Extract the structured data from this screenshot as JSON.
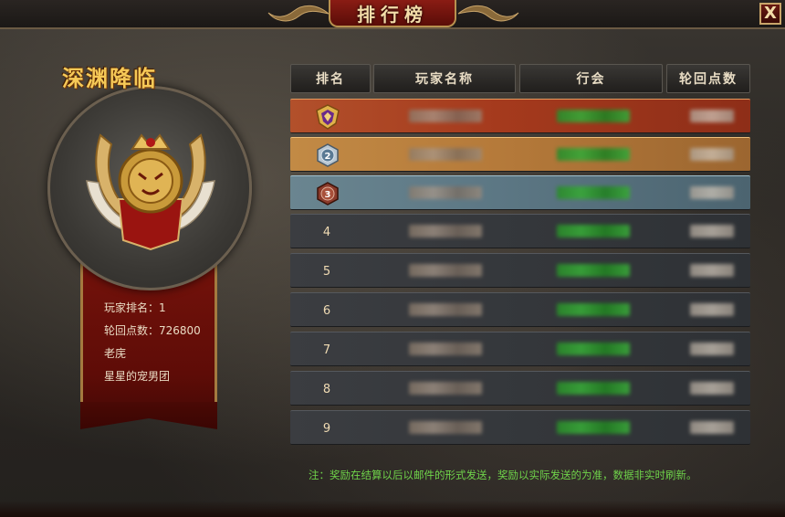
{
  "window": {
    "title": "排行榜",
    "close_label": "X"
  },
  "player": {
    "rank_title": "深渊降临",
    "rank_line": "玩家排名：1",
    "points_line": "轮回点数：726800",
    "name": "老庑",
    "guild": "星星的宠男团"
  },
  "table": {
    "headers": {
      "rank": "排名",
      "name": "玩家名称",
      "guild": "行会",
      "points": "轮回点数"
    },
    "rows": [
      {
        "rank": "1"
      },
      {
        "rank": "2"
      },
      {
        "rank": "3"
      },
      {
        "rank": "4"
      },
      {
        "rank": "5"
      },
      {
        "rank": "6"
      },
      {
        "rank": "7"
      },
      {
        "rank": "8"
      },
      {
        "rank": "9"
      }
    ]
  },
  "note": "注：奖励在结算以后以邮件的形式发送，奖励以实际发送的为准，数据非实时刷新。",
  "icons": {
    "medal_gold": "medal-gold-icon",
    "medal_silver": "medal-silver-icon",
    "medal_bronze": "medal-bronze-icon"
  }
}
